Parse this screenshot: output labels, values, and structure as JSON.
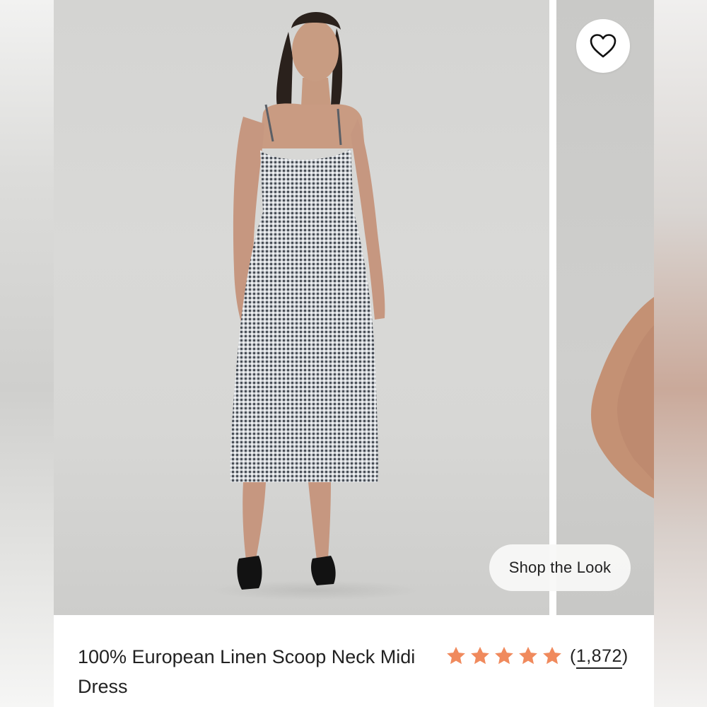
{
  "product": {
    "title": "100% European Linen Scoop Neck Midi Dress",
    "rating": 5,
    "review_count": "1,872",
    "review_open": "(",
    "review_close": ")"
  },
  "gallery": {
    "shop_the_look_label": "Shop the Look",
    "favorite_icon": "heart-outline-icon"
  },
  "colors": {
    "star": "#F08A5D",
    "backdrop": "#D6D6D4",
    "text": "#222222"
  }
}
